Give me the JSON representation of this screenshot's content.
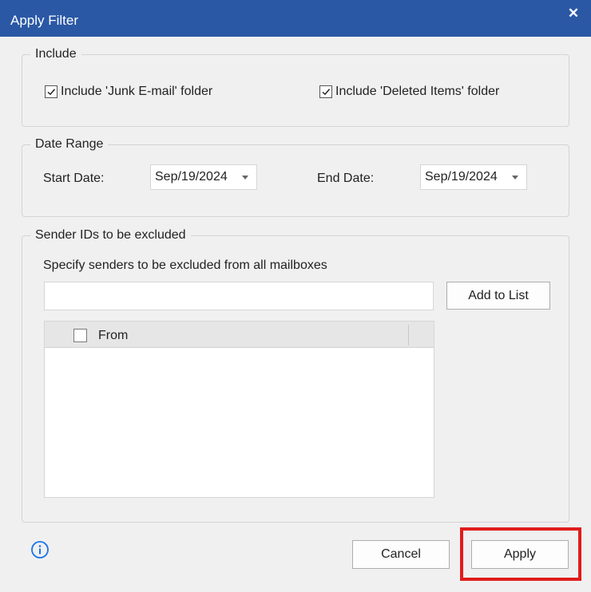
{
  "window": {
    "title": "Apply Filter",
    "close_icon": "close-icon"
  },
  "include": {
    "legend": "Include",
    "junk_label": "Include 'Junk E-mail' folder",
    "junk_checked": true,
    "deleted_label": "Include 'Deleted Items' folder",
    "deleted_checked": true
  },
  "date_range": {
    "legend": "Date Range",
    "start_label": "Start Date:",
    "start_value": "Sep/19/2024",
    "end_label": "End Date:",
    "end_value": "Sep/19/2024"
  },
  "sender": {
    "legend": "Sender IDs to be excluded",
    "description": "Specify senders to be excluded from all mailboxes",
    "input_value": "",
    "input_placeholder": "",
    "add_button": "Add to List",
    "list_columns": [
      "From"
    ],
    "list_rows": []
  },
  "footer": {
    "info_icon": "info-icon",
    "cancel_button": "Cancel",
    "apply_button": "Apply",
    "highlight_color": "#e01c1c"
  },
  "colors": {
    "titlebar": "#2a58a5",
    "background": "#f0f0f0"
  }
}
